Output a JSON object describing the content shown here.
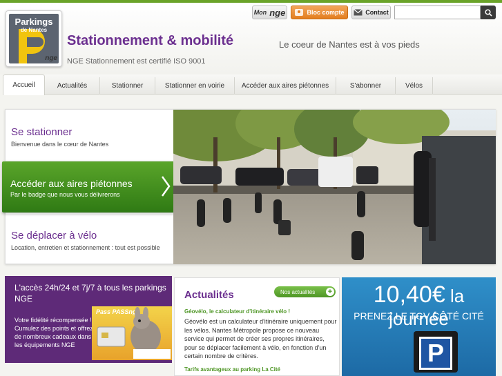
{
  "header": {
    "logo_line1": "Parkings",
    "logo_line2": "de Nantes",
    "logo_nge": "nge",
    "headline": "Stationnement & mobilité",
    "tagline": "Le coeur de Nantes est à vos pieds",
    "certification": "NGE Stationnement est certifié ISO 9001"
  },
  "toolbar": {
    "mon_prefix": "Mon",
    "mon_nge": "nge",
    "bloc_compte": "Bloc compte",
    "contact": "Contact",
    "search_placeholder": ""
  },
  "nav": {
    "items": [
      {
        "label": "Accueil"
      },
      {
        "label": "Actualités"
      },
      {
        "label": "Stationner"
      },
      {
        "label": "Stationner en voirie"
      },
      {
        "label": "Accéder aux aires piétonnes"
      },
      {
        "label": "S'abonner"
      },
      {
        "label": "Vélos"
      }
    ],
    "active_index": 0
  },
  "feature": {
    "items": [
      {
        "title": "Se stationner",
        "subtitle": "Bienvenue dans le cœur de Nantes"
      },
      {
        "title": "Accéder aux aires piétonnes",
        "subtitle": "Par le badge que nous vous délivrerons"
      },
      {
        "title": "Se déplacer à vélo",
        "subtitle": "Location, entretien et stationnement : tout est possible"
      }
    ],
    "selected_index": 1
  },
  "promo": {
    "title": "L'accès 24h/24 et 7j/7 à tous les parkings NGE",
    "text": "Votre fidélité récompensée ! Cumulez des points et offrez de nombreux cadeaux dans les équipements NGE",
    "image_label": "Pass PASSnge"
  },
  "news": {
    "title": "Actualités",
    "button": "Nos actualités",
    "item1_title": "Géovélo, le calculateur d'itinéraire vélo !",
    "item1_text": "Géovélo est un calculateur d'itinéraire uniquement pour les vélos. Nantes Métropole propose ce nouveau service qui permet de créer ses propres itinéraires, pour se déplacer facilement à vélo, en fonction d'un certain nombre de critères.",
    "item2_title": "Tarifs avantageux au parking La Cité"
  },
  "ad": {
    "price": "10,40€",
    "price_suffix": "la journée",
    "subtitle": "PRENEZ LE TGV CÔTÉ CITÉ",
    "sign": "P"
  },
  "colors": {
    "brand_purple": "#6b2f8f",
    "brand_green": "#4e9625",
    "accent_orange": "#e37e1f",
    "ad_blue": "#1d6aa5"
  }
}
